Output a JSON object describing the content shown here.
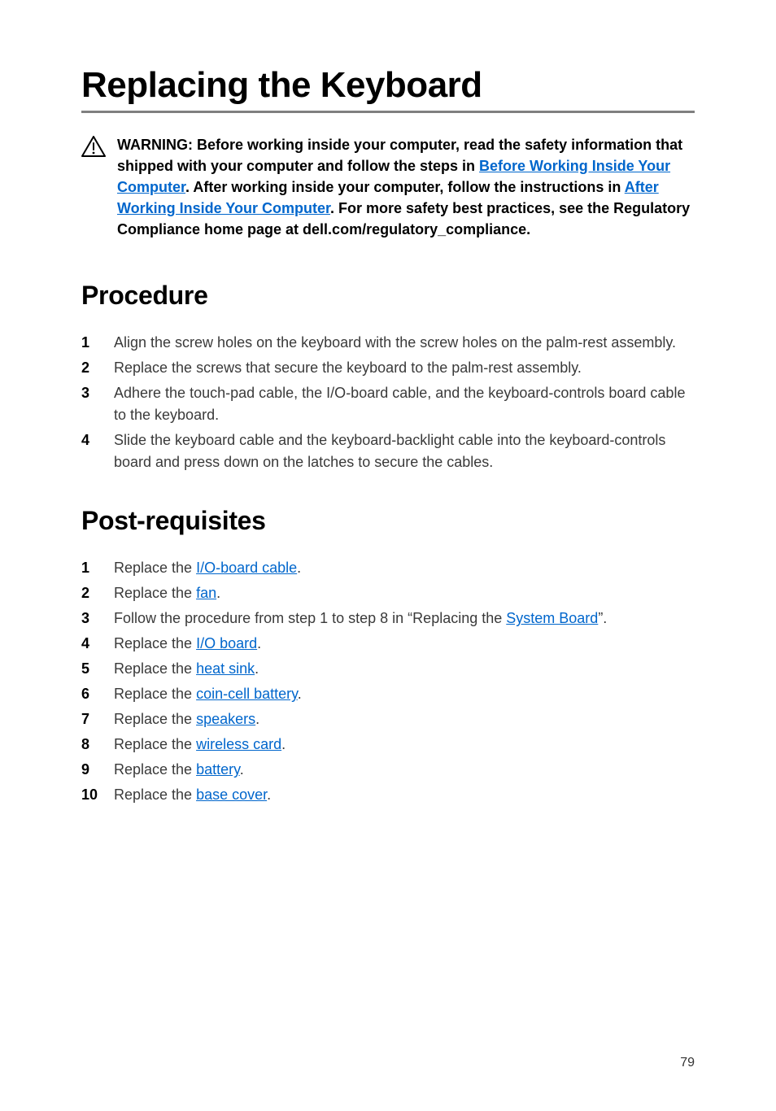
{
  "title": "Replacing the Keyboard",
  "warning": {
    "pre1": "WARNING: Before working inside your computer, read the safety information that shipped with your computer and follow the steps in ",
    "link1": "Before Working Inside Your Computer",
    "mid1": ". After working inside your computer, follow the instructions in ",
    "link2": "After Working Inside Your Computer",
    "post1": ". For more safety best practices, see the Regulatory Compliance home page at dell.com/regulatory_compliance."
  },
  "sections": {
    "procedure": {
      "heading": "Procedure",
      "steps": [
        "Align the screw holes on the keyboard with the screw holes on the palm-rest assembly.",
        "Replace the screws that secure the keyboard to the palm-rest assembly.",
        "Adhere the touch-pad cable, the I/O-board cable, and the keyboard-controls board cable to the keyboard.",
        "Slide the keyboard cable and the keyboard-backlight cable into the keyboard-controls board and press down on the latches to secure the cables."
      ]
    },
    "post": {
      "heading": "Post-requisites",
      "steps": [
        {
          "pre": "Replace the ",
          "link": "I/O-board cable",
          "post": "."
        },
        {
          "pre": "Replace the ",
          "link": "fan",
          "post": "."
        },
        {
          "pre": "Follow the procedure from step 1 to step 8 in “Replacing the ",
          "link": "System Board",
          "post": "”."
        },
        {
          "pre": "Replace the ",
          "link": "I/O board",
          "post": "."
        },
        {
          "pre": "Replace the ",
          "link": "heat sink",
          "post": "."
        },
        {
          "pre": "Replace the ",
          "link": "coin-cell battery",
          "post": "."
        },
        {
          "pre": "Replace the ",
          "link": "speakers",
          "post": "."
        },
        {
          "pre": "Replace the ",
          "link": "wireless card",
          "post": "."
        },
        {
          "pre": "Replace the ",
          "link": "battery",
          "post": "."
        },
        {
          "pre": "Replace the ",
          "link": "base cover",
          "post": "."
        }
      ]
    }
  },
  "page_number": "79"
}
